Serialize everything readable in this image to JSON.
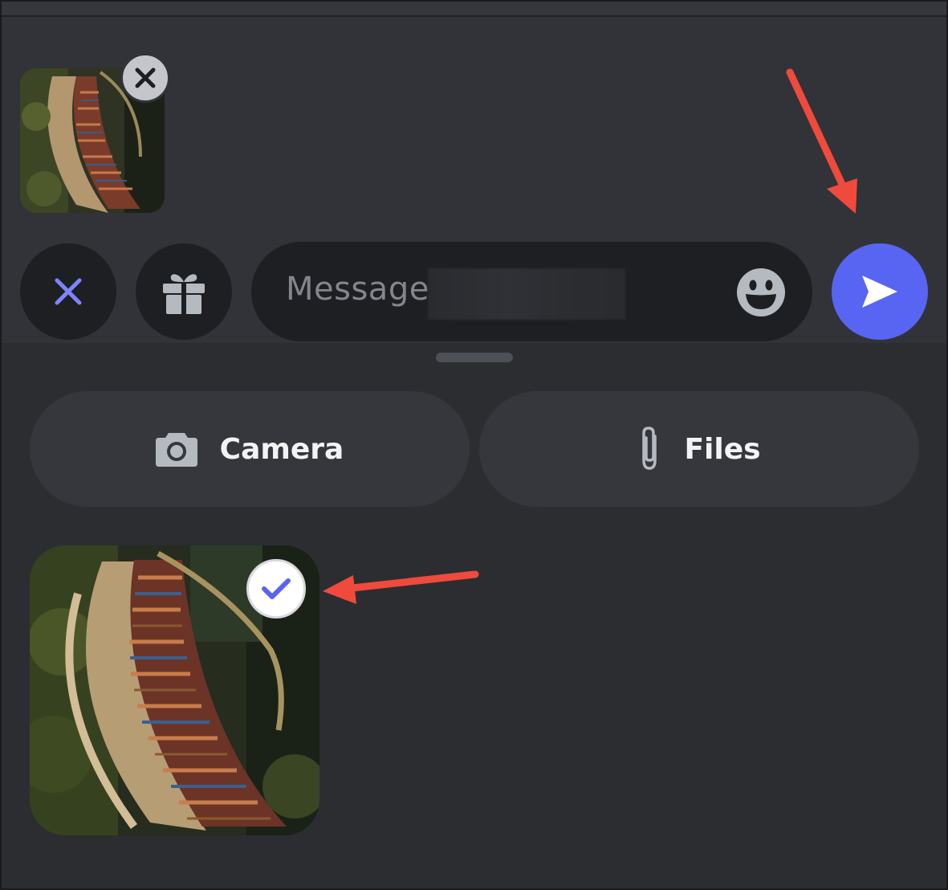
{
  "composer": {
    "attachment": {
      "thumbnail": "staircase-bookshelf-photo",
      "remove_icon": "close-icon"
    },
    "buttons": {
      "close_icon": "close-icon",
      "gift_icon": "gift-icon",
      "emoji_icon": "emoji-smile-icon",
      "send_icon": "send-icon"
    },
    "message": {
      "placeholder": "Message"
    }
  },
  "picker": {
    "camera": {
      "label": "Camera",
      "icon": "camera-icon"
    },
    "files": {
      "label": "Files",
      "icon": "paperclip-icon"
    },
    "gallery": [
      {
        "thumbnail": "staircase-bookshelf-photo",
        "selected": true
      }
    ]
  },
  "colors": {
    "background": "#2b2d31",
    "composer_bg": "#313338",
    "input_bg": "#1e1f22",
    "accent": "#5865f2",
    "close_icon": "#7c85ff",
    "annotation_arrow": "#ef4a3c"
  }
}
